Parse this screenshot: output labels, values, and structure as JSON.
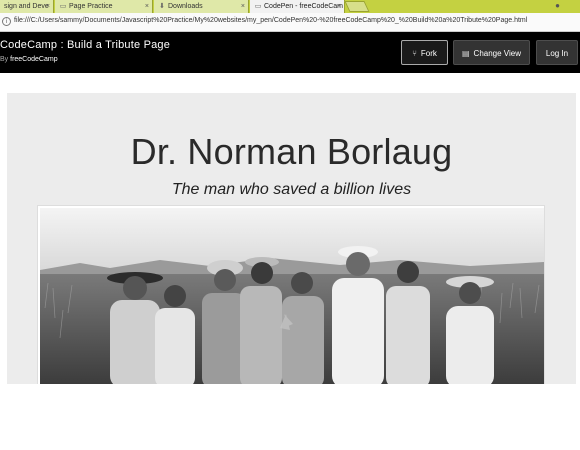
{
  "browser": {
    "tabs": [
      {
        "label": "sign and Deve",
        "close": "×"
      },
      {
        "label": "Page Practice",
        "close": "×"
      },
      {
        "label": "Downloads",
        "close": "×"
      },
      {
        "label": "CodePen - freeCodeCam",
        "close": "×"
      }
    ],
    "url": "file:///C:/Users/sammy/Documents/Javascript%20Practice/My%20websites/my_pen/CodePen%20-%20freeCodeCamp%20_%20Build%20a%20Tribute%20Page.html"
  },
  "header": {
    "title": "CodeCamp : Build a Tribute Page",
    "by_prefix": "By",
    "author": "freeCodeCamp",
    "fork_label": "Fork",
    "change_view_label": "Change View",
    "login_label": "Log In"
  },
  "tribute": {
    "heading": "Dr. Norman Borlaug",
    "subheading": "The man who saved a billion lives"
  }
}
